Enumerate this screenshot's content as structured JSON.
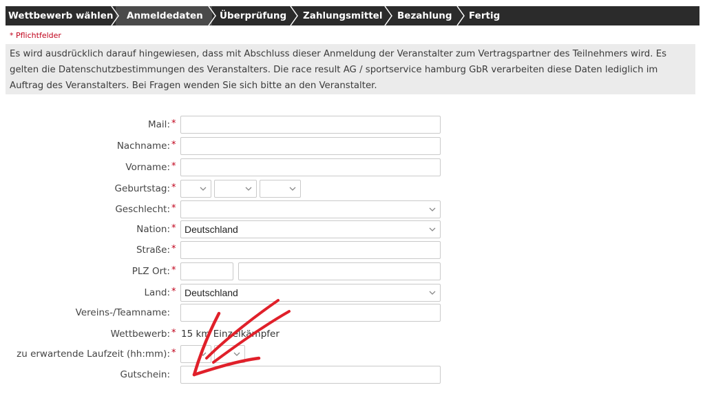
{
  "steps": [
    {
      "label": "Wettbewerb wählen",
      "active": false
    },
    {
      "label": "Anmeldedaten",
      "active": true
    },
    {
      "label": "Überprüfung",
      "active": false
    },
    {
      "label": "Zahlungsmittel",
      "active": false
    },
    {
      "label": "Bezahlung",
      "active": false
    },
    {
      "label": "Fertig",
      "active": false
    }
  ],
  "required_note": "* Pflichtfelder",
  "notice": "Es wird ausdrücklich darauf hingewiesen, dass mit Abschluss dieser Anmeldung der Veranstalter zum Vertragspartner des Teilnehmers wird. Es gelten die Datenschutzbestimmungen des Veranstalters. Die race result AG / sportservice hamburg GbR verarbeiten diese Daten lediglich im Auftrag des Veranstalters. Bei Fragen wenden Sie sich bitte an den Veranstalter.",
  "form": {
    "mail": {
      "label": "Mail:",
      "value": ""
    },
    "nachname": {
      "label": "Nachname:",
      "value": ""
    },
    "vorname": {
      "label": "Vorname:",
      "value": ""
    },
    "geburtstag": {
      "label": "Geburtstag:",
      "day": "",
      "month": "",
      "year": ""
    },
    "geschlecht": {
      "label": "Geschlecht:",
      "value": ""
    },
    "nation": {
      "label": "Nation:",
      "value": "Deutschland"
    },
    "strasse": {
      "label": "Straße:",
      "value": ""
    },
    "plz_ort": {
      "label": "PLZ Ort:",
      "plz": "",
      "ort": ""
    },
    "land": {
      "label": "Land:",
      "value": "Deutschland"
    },
    "verein": {
      "label": "Vereins-/Teamname:",
      "value": ""
    },
    "wettbewerb": {
      "label": "Wettbewerb:",
      "value": "15 km Einzelkämpfer"
    },
    "laufzeit": {
      "label": "zu erwartende Laufzeit (hh:mm):",
      "hh": "",
      "mm": ""
    },
    "gutschein": {
      "label": "Gutschein:",
      "value": ""
    }
  },
  "required_marker": "*",
  "colors": {
    "stepbar": "#2b2b2b",
    "required": "#c0001a",
    "annotation": "#e0202a",
    "notice_bg": "#ebebeb"
  },
  "icons": {
    "chevron": "chevron-down-icon",
    "step_separator": "chevron-right-icon"
  }
}
